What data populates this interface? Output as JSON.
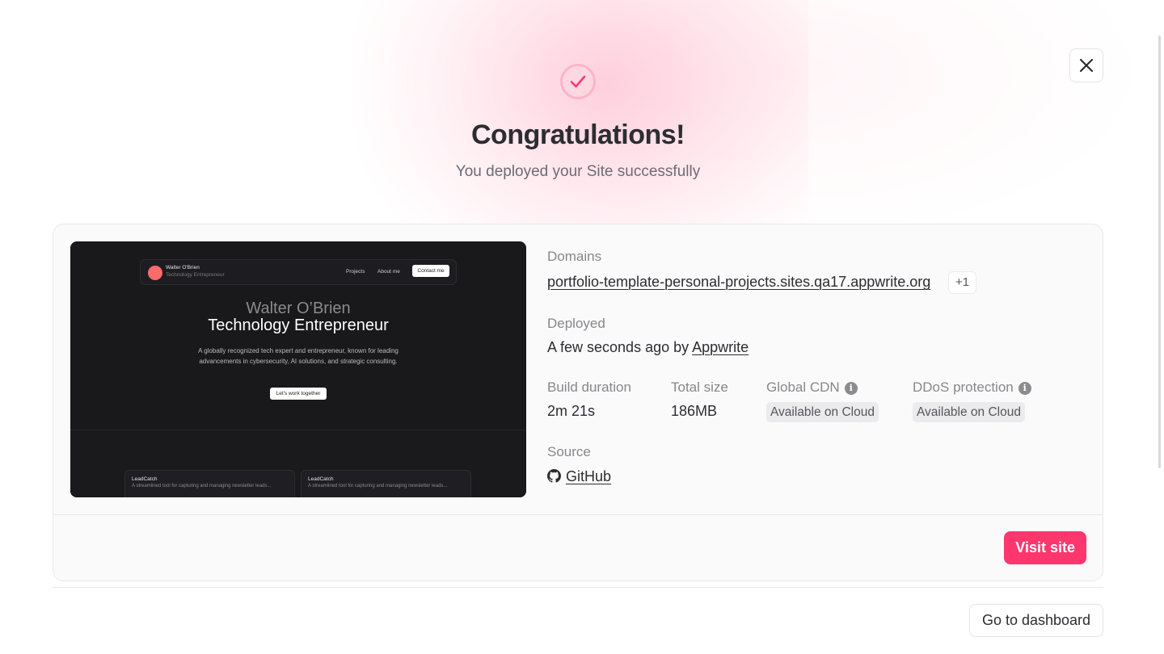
{
  "header": {
    "title": "Congratulations!",
    "subtitle": "You deployed your Site successfully"
  },
  "icons": {
    "success": "checkmark-circle-icon",
    "close": "close-icon",
    "github": "github-icon",
    "info": "info-icon"
  },
  "preview": {
    "name": "Walter O'Brien",
    "role": "Technology Entrepreneur",
    "nav": [
      "Projects",
      "About me"
    ],
    "contact": "Contact me",
    "heading_line1": "Walter O’Brien",
    "heading_line2": "Technology Entrepreneur",
    "description": "A globally recognized tech expert and entrepreneur, known for leading advancements in cybersecurity, AI solutions, and strategic consulting.",
    "cta": "Let's work together",
    "cards": [
      {
        "title": "LeadCatch",
        "desc": "A streamlined tool for capturing and managing newsletter leads..."
      },
      {
        "title": "LeadCatch",
        "desc": "A streamlined tool for capturing and managing newsletter leads..."
      }
    ]
  },
  "details": {
    "domains_label": "Domains",
    "domain": "portfolio-template-personal-projects.sites.qa17.appwrite.org",
    "extra_domains": "+1",
    "deployed_label": "Deployed",
    "deployed_text": "A few seconds ago by",
    "deployed_by": "Appwrite",
    "build_duration_label": "Build duration",
    "build_duration": "2m 21s",
    "total_size_label": "Total size",
    "total_size": "186MB",
    "global_cdn_label": "Global CDN",
    "global_cdn_value": "Available on Cloud",
    "ddos_label": "DDoS protection",
    "ddos_value": "Available on Cloud",
    "source_label": "Source",
    "source_value": "GitHub"
  },
  "actions": {
    "visit_site": "Visit site",
    "go_to_dashboard": "Go to dashboard"
  },
  "colors": {
    "accent": "#fd366e",
    "text": "#2d2d31",
    "muted": "#87878c"
  }
}
